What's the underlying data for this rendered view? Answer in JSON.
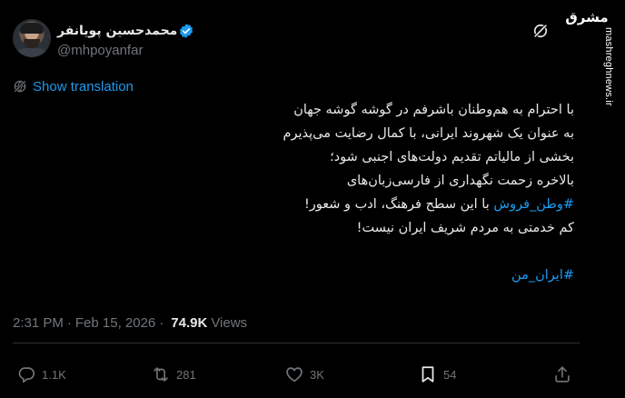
{
  "author": {
    "display_name": "محمدحسین پویانفر",
    "handle": "@mhpoyanfar",
    "verified_icon": "verified-badge-icon",
    "accent_color": "#1d9bf0"
  },
  "header": {
    "grok_icon": "grok-icon",
    "logo_text": "مشرق",
    "watermark": "mashreghnews.ir"
  },
  "translation": {
    "label": "Show translation",
    "icon": "globe-icon"
  },
  "tweet": {
    "lines": [
      "با احترام به هم‌وطنان باشرفم در گوشه گوشه جهان",
      "به عنوان یک شهروند ایرانی، با کمال رضایت می‌پذیرم",
      "بخشی از مالیاتم تقدیم دولت‌های اجنبی شود؛",
      "بالاخره زحمت نگهداری از فارسی‌زبان‌های"
    ],
    "hashtag_line": {
      "hashtag": "#وطن_فروش",
      "rest": " با این سطح فرهنگ، ادب و شعور!"
    },
    "line_last": "کم خدمتی به مردم شریف ایران نیست!",
    "hashtag_end": "#ایران_من"
  },
  "meta": {
    "time": "2:31 PM",
    "separator": "·",
    "date": "Feb 15, 2026",
    "views_count": "74.9K",
    "views_label": "Views"
  },
  "actions": {
    "reply_count": "1.1K",
    "retweet_count": "281",
    "like_count": "3K",
    "bookmark_count": "54"
  },
  "colors": {
    "background": "#000000",
    "text": "#e7e9ea",
    "secondary": "#71767b",
    "link": "#1d9bf0",
    "divider": "#2f3336"
  }
}
